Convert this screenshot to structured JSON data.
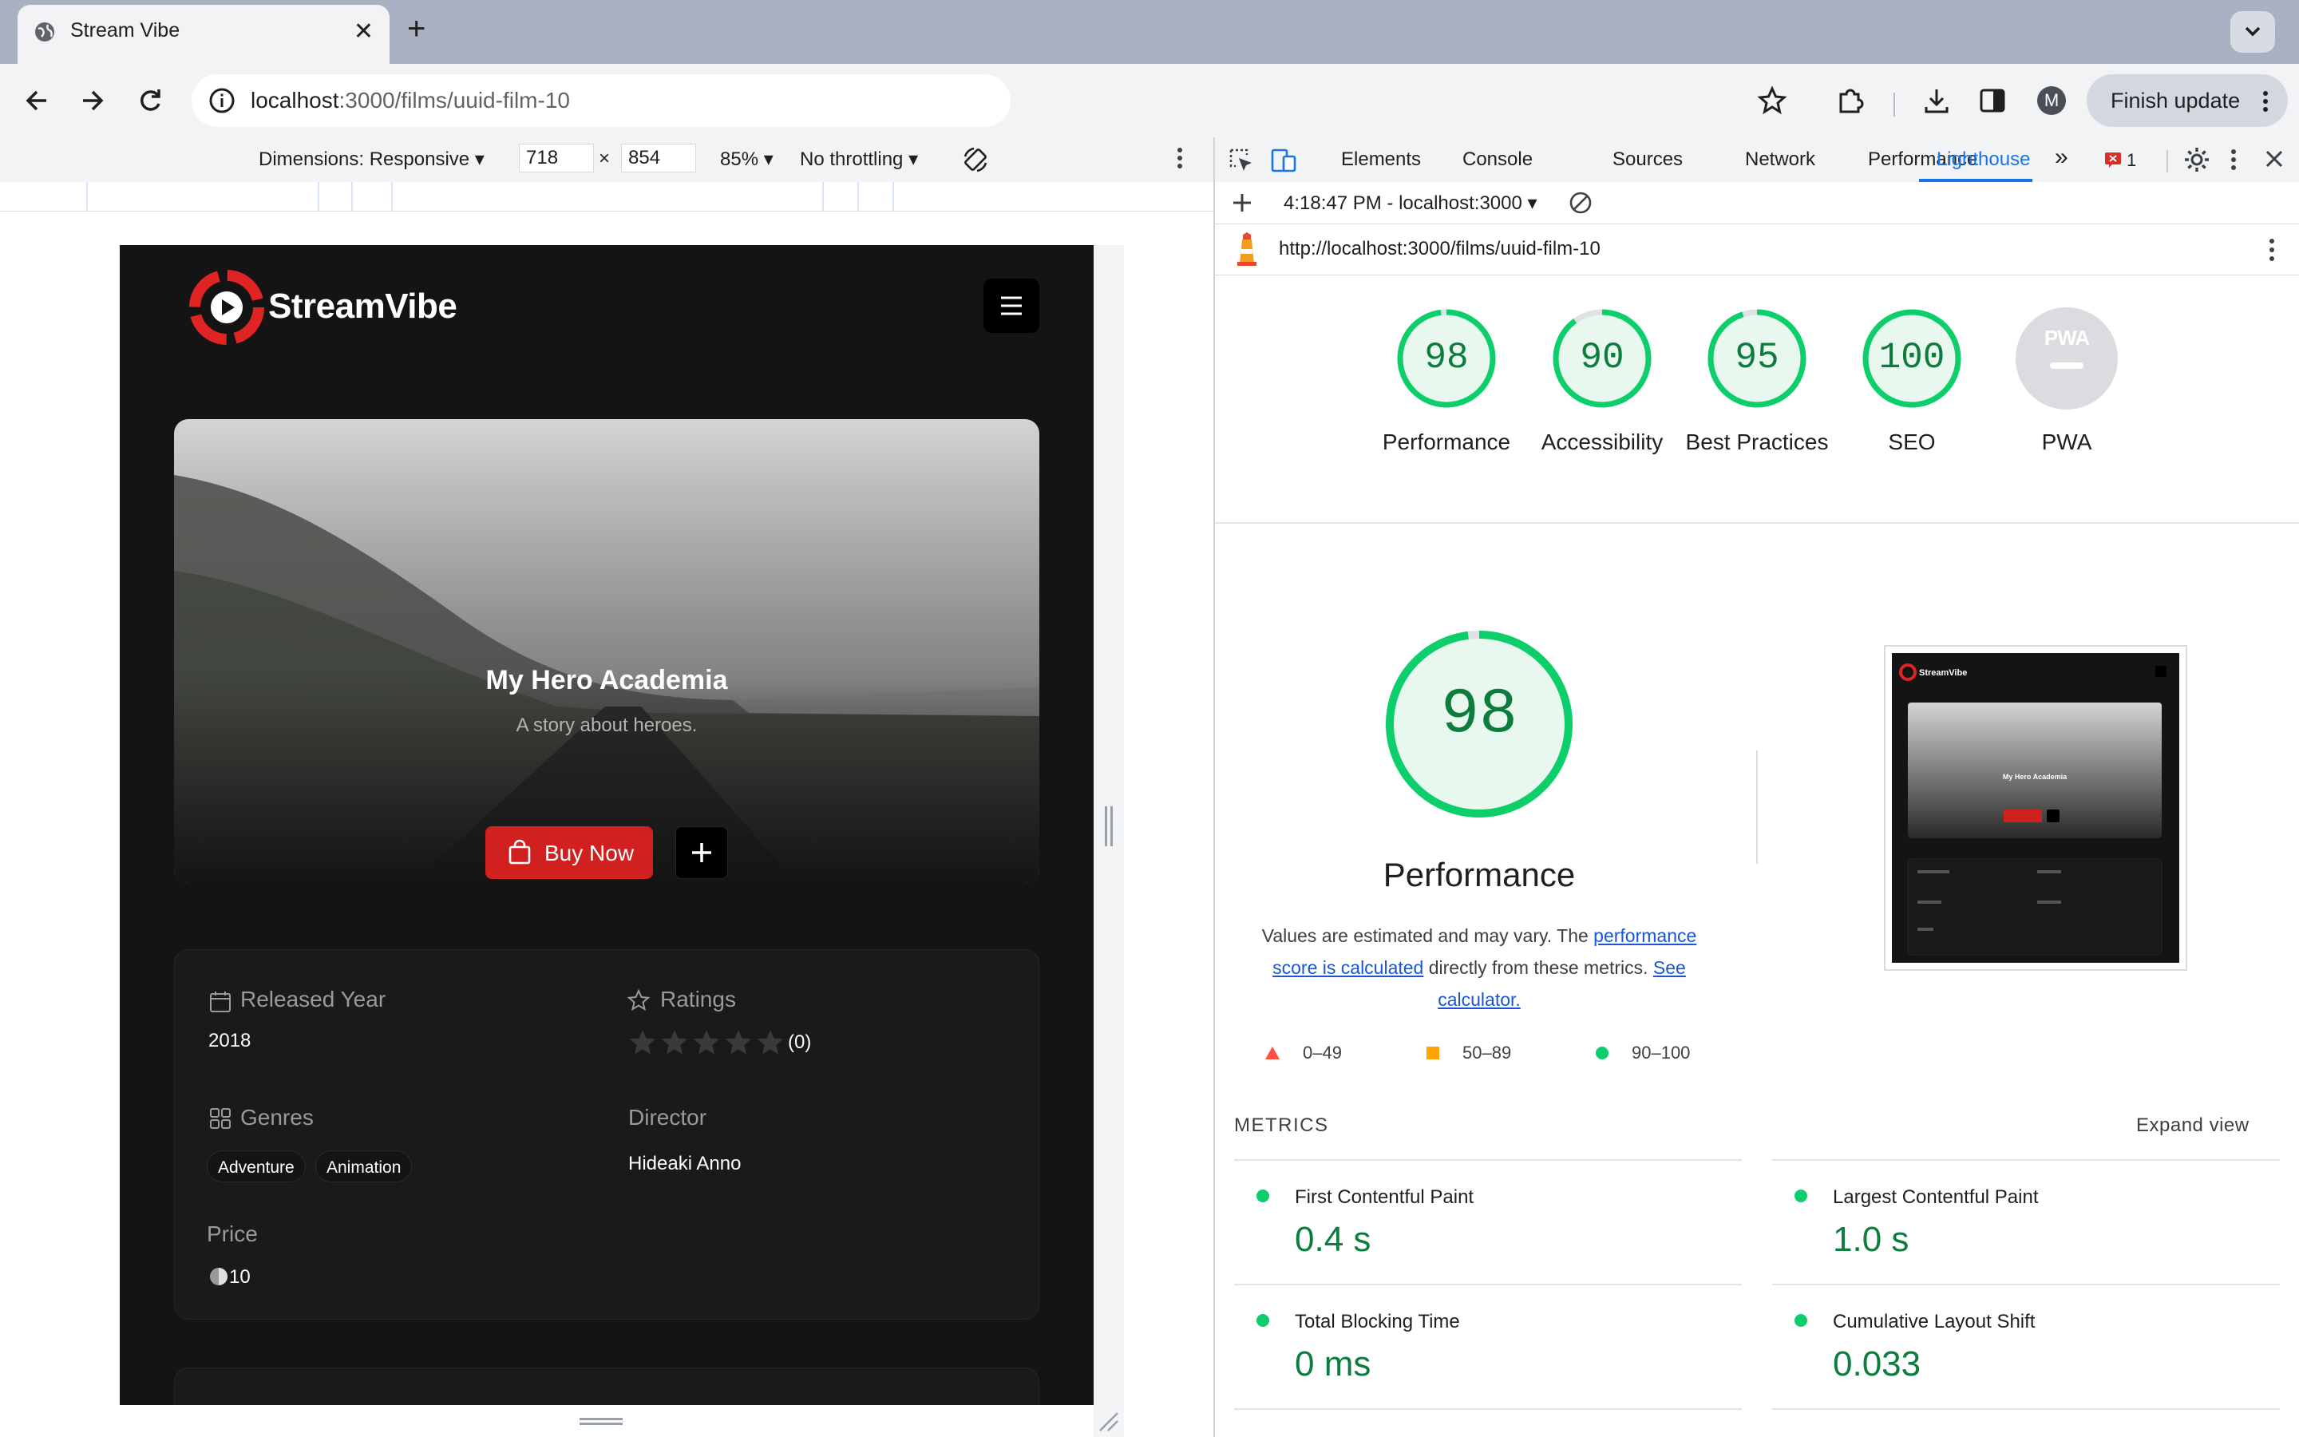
{
  "browser": {
    "tab_title": "Stream Vibe",
    "url_host": "localhost",
    "url_path": ":3000/films/uuid-film-10",
    "update_button": "Finish update",
    "profile_initial": "M"
  },
  "device_toolbar": {
    "dimensions_label": "Dimensions: Responsive",
    "width": "718",
    "times": "×",
    "height": "854",
    "zoom": "85%",
    "throttling": "No throttling"
  },
  "site": {
    "brand": "StreamVibe",
    "hero": {
      "title": "My Hero Academia",
      "subtitle": "A story about heroes.",
      "buy_label": "Buy Now"
    },
    "details": {
      "released_label": "Released Year",
      "released_value": "2018",
      "ratings_label": "Ratings",
      "ratings_count": "(0)",
      "rating_stars": 0,
      "genres_label": "Genres",
      "genres": [
        "Adventure",
        "Animation"
      ],
      "director_label": "Director",
      "director_value": "Hideaki Anno",
      "price_label": "Price",
      "price_value": "10"
    }
  },
  "devtools": {
    "tabs": [
      "Elements",
      "Console",
      "Sources",
      "Network",
      "Performance",
      "Lighthouse"
    ],
    "active_tab": "Lighthouse",
    "more_tabs": "»",
    "issues_count": "1",
    "report_time": "4:18:47 PM - localhost:3000",
    "report_url": "http://localhost:3000/films/uuid-film-10"
  },
  "lighthouse": {
    "scores": [
      {
        "label": "Performance",
        "score": "98",
        "value": 98
      },
      {
        "label": "Accessibility",
        "score": "90",
        "value": 90
      },
      {
        "label": "Best Practices",
        "score": "95",
        "value": 95
      },
      {
        "label": "SEO",
        "score": "100",
        "value": 100
      }
    ],
    "pwa_label": "PWA",
    "pwa_badge": "PWA",
    "main_score": "98",
    "main_title": "Performance",
    "desc_1": "Values are estimated and may vary. The ",
    "desc_link_1": "performance score is calculated",
    "desc_2": " directly from these metrics. ",
    "desc_link_2": "See calculator.",
    "legend": [
      "0–49",
      "50–89",
      "90–100"
    ],
    "metrics_header": "METRICS",
    "expand_view": "Expand view",
    "metrics": [
      {
        "name": "First Contentful Paint",
        "value": "0.4 s"
      },
      {
        "name": "Largest Contentful Paint",
        "value": "1.0 s"
      },
      {
        "name": "Total Blocking Time",
        "value": "0 ms"
      },
      {
        "name": "Cumulative Layout Shift",
        "value": "0.033"
      }
    ],
    "colors": {
      "pass": "#0cce6b",
      "average": "#ffa400",
      "fail": "#ff4e42",
      "pass_text": "#0c7d3c"
    }
  }
}
